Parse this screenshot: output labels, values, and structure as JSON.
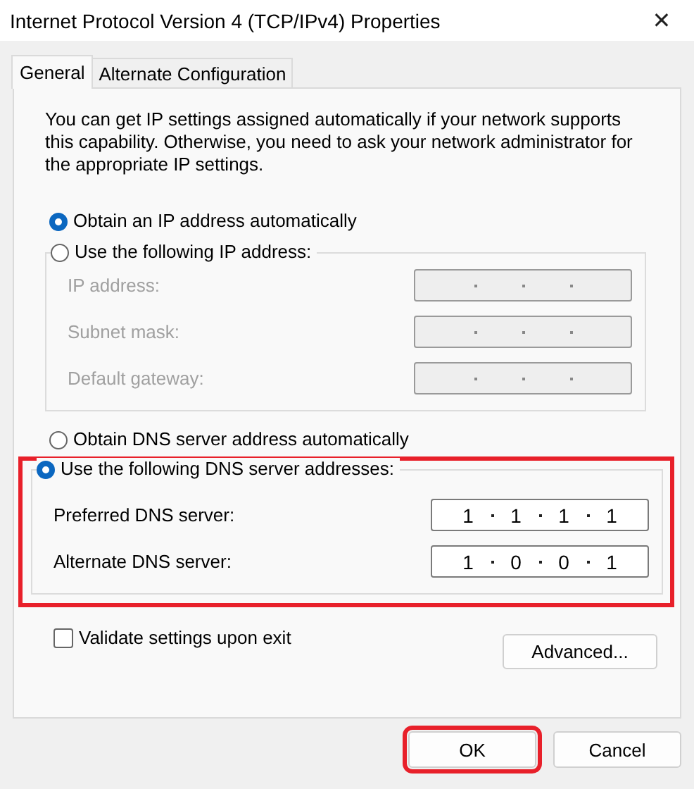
{
  "window": {
    "title": "Internet Protocol Version 4 (TCP/IPv4) Properties",
    "close": "✕"
  },
  "tabs": [
    {
      "label": "General",
      "selected": true
    },
    {
      "label": "Alternate Configuration",
      "selected": false
    }
  ],
  "description": "You can get IP settings assigned automatically if your network supports this capability. Otherwise, you need to ask your network administrator for the appropriate IP settings.",
  "ip_options": [
    {
      "label": "Obtain an IP address automatically",
      "selected": true
    },
    {
      "label": "Use the following IP address:",
      "selected": false
    }
  ],
  "ip_fields": [
    {
      "label": "IP address:",
      "disabled": true
    },
    {
      "label": "Subnet mask:",
      "disabled": true
    },
    {
      "label": "Default gateway:",
      "disabled": true
    }
  ],
  "dns_options": [
    {
      "label": "Obtain DNS server address automatically",
      "selected": false
    },
    {
      "label": "Use the following DNS server addresses:",
      "selected": true
    }
  ],
  "dns_highlighted": true,
  "dns_fields": [
    {
      "label": "Preferred DNS server:",
      "disabled": false,
      "octets": [
        "1",
        "1",
        "1",
        "1"
      ]
    },
    {
      "label": "Alternate DNS server:",
      "disabled": false,
      "octets": [
        "1",
        "0",
        "0",
        "1"
      ]
    }
  ],
  "validate": {
    "label": "Validate settings upon exit",
    "checked": false
  },
  "advanced_button": "Advanced...",
  "buttons": [
    {
      "label": "OK",
      "highlighted": true
    },
    {
      "label": "Cancel",
      "highlighted": false
    }
  ]
}
